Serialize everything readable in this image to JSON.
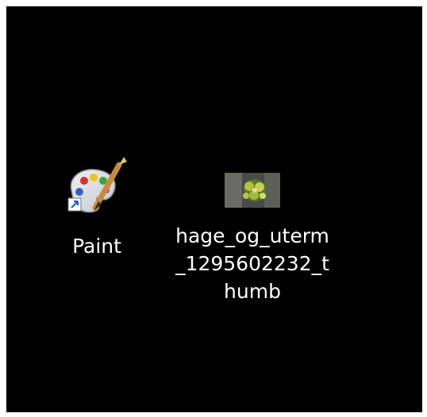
{
  "desktop": {
    "icons": [
      {
        "label": "Paint",
        "icon": "paint-app-icon",
        "shortcut": true
      },
      {
        "label": "hage_og_uterm_1295602232_thumb",
        "icon": "image-thumbnail-icon"
      }
    ]
  },
  "colors": {
    "background": "#000000",
    "label_text": "#ffffff",
    "frame": "#ffffff"
  }
}
